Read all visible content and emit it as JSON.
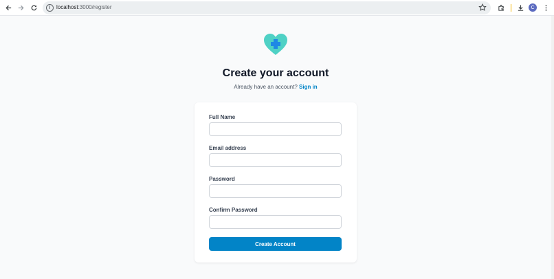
{
  "browser": {
    "url_host": "localhost",
    "url_path": ":3000/register",
    "profile_initial": "C"
  },
  "page": {
    "title": "Create your account",
    "subtitle_prefix": "Already have an account?",
    "signin_link": "Sign in"
  },
  "form": {
    "full_name_label": "Full Name",
    "full_name_value": "",
    "email_label": "Email address",
    "email_value": "",
    "password_label": "Password",
    "password_value": "",
    "confirm_label": "Confirm Password",
    "confirm_value": "",
    "submit_label": "Create Account"
  },
  "colors": {
    "accent": "#0284c7",
    "logo_heart": "#4fd1c5",
    "logo_cross": "#1e88e5"
  }
}
